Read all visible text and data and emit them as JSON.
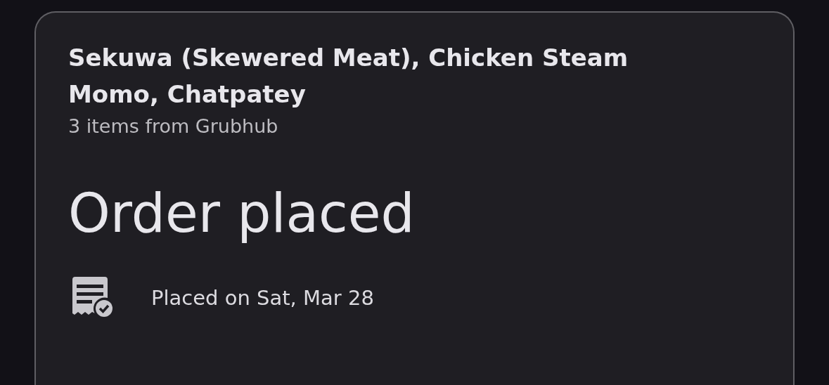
{
  "order": {
    "title": "Sekuwa (Skewered Meat), Chicken Steam Momo, Chatpatey",
    "subtitle": "3 items from Grubhub",
    "status": "Order placed",
    "details": [
      {
        "kind": "receipt",
        "text": "Placed on Sat, Mar 28"
      }
    ]
  }
}
